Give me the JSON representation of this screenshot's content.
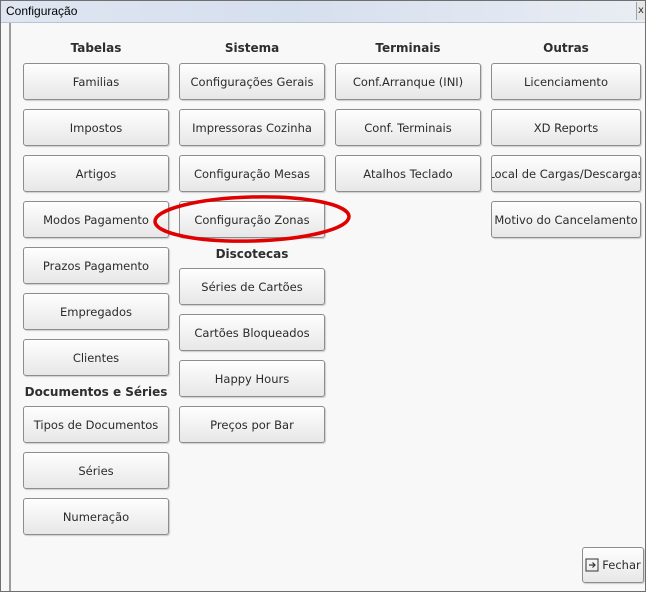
{
  "window": {
    "title": "Configuração",
    "close_glyph": "x"
  },
  "tabelas": {
    "heading": "Tabelas",
    "items": [
      "Familias",
      "Impostos",
      "Artigos",
      "Modos Pagamento",
      "Prazos Pagamento",
      "Empregados",
      "Clientes"
    ]
  },
  "documentos": {
    "heading": "Documentos e Séries",
    "items": [
      "Tipos de Documentos",
      "Séries",
      "Numeração"
    ]
  },
  "sistema": {
    "heading": "Sistema",
    "items": [
      "Configurações Gerais",
      "Impressoras Cozinha",
      "Configuração Mesas",
      "Configuração Zonas"
    ]
  },
  "discotecas": {
    "heading": "Discotecas",
    "items": [
      "Séries de Cartões",
      "Cartões Bloqueados",
      "Happy Hours",
      "Preços por Bar"
    ]
  },
  "terminais": {
    "heading": "Terminais",
    "items": [
      "Conf.Arranque (INI)",
      "Conf. Terminais",
      "Atalhos Teclado"
    ]
  },
  "outras": {
    "heading": "Outras",
    "items": [
      "Licenciamento",
      "XD Reports",
      "Local de Cargas/Descargas",
      "Motivo do Cancelamento"
    ]
  },
  "footer": {
    "close_label": "Fechar"
  },
  "icons": {
    "exit": "exit-icon"
  },
  "colors": {
    "annotation_ellipse": "#e00000"
  }
}
